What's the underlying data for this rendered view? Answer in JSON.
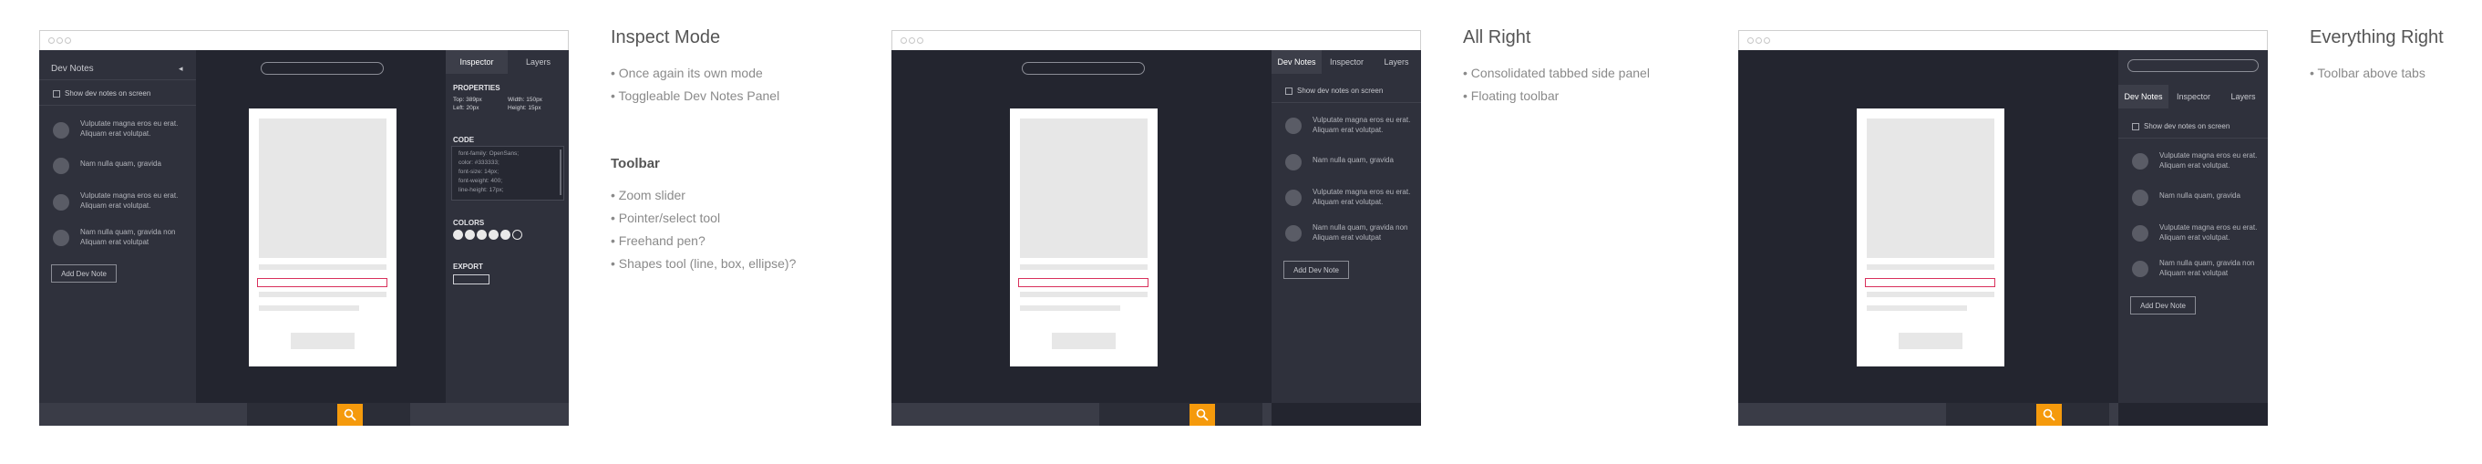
{
  "zoom_icon": "magnifier-icon",
  "accent": "#f59a0c",
  "panel1": {
    "dev_notes_title": "Dev Notes",
    "collapse_glyph": "◂",
    "show_checkbox_label": "Show dev notes on screen",
    "notes": [
      "Vulputate magna eros eu erat. Aliquam erat volutpat.",
      "Nam nulla quam, gravida",
      "Vulputate magna eros eu erat. Aliquam erat volutpat.",
      "Nam nulla quam, gravida non Aliquam erat volutpat"
    ],
    "add_button": "Add Dev Note",
    "tabs": [
      "Inspector",
      "Layers"
    ],
    "properties_title": "PROPERTIES",
    "prop_top": "Top: 389px",
    "prop_width": "Width: 150px",
    "prop_left": "Left: 20px",
    "prop_height": "Height: 15px",
    "code_title": "CODE",
    "code_lines": [
      "font-family: OpenSans;",
      "color: #333333;",
      "font-size: 14px;",
      "font-weight: 400;",
      "line-height: 17px;"
    ],
    "colors_title": "COLORS",
    "export_title": "EXPORT"
  },
  "panel2": {
    "tabs": [
      "Dev Notes",
      "Inspector",
      "Layers"
    ],
    "show_checkbox_label": "Show dev notes on screen",
    "notes": [
      "Vulputate magna eros eu erat. Aliquam erat volutpat.",
      "Nam nulla quam, gravida",
      "Vulputate magna eros eu erat. Aliquam erat volutpat.",
      "Nam nulla quam, gravida non Aliquam erat volutpat"
    ],
    "add_button": "Add Dev Note"
  },
  "panel3": {
    "tabs": [
      "Dev Notes",
      "Inspector",
      "Layers"
    ],
    "show_checkbox_label": "Show dev notes on screen",
    "notes": [
      "Vulputate magna eros eu erat. Aliquam erat volutpat.",
      "Nam nulla quam, gravida",
      "Vulputate magna eros eu erat. Aliquam erat volutpat.",
      "Nam nulla quam, gravida non Aliquam erat volutpat"
    ],
    "add_button": "Add Dev Note"
  },
  "desc1": {
    "title": "Inspect Mode",
    "bullets": [
      "• Once again its own mode",
      "• Toggleable Dev Notes Panel"
    ],
    "toolbar_title": "Toolbar",
    "toolbar_bullets": [
      "• Zoom slider",
      "• Pointer/select tool",
      "• Freehand pen?",
      "• Shapes tool (line, box, ellipse)?"
    ]
  },
  "desc2": {
    "title": "All Right",
    "bullets": [
      "• Consolidated tabbed side panel",
      "• Floating toolbar"
    ]
  },
  "desc3": {
    "title": "Everything Right",
    "bullets": [
      "• Toolbar above tabs"
    ]
  }
}
